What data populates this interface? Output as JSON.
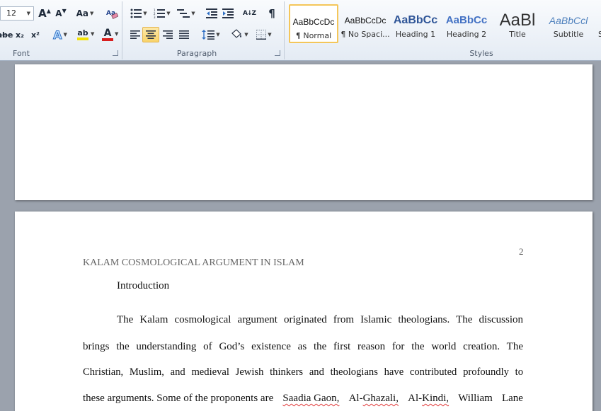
{
  "ribbon": {
    "font": {
      "label": "Font",
      "size": "12",
      "grow_glyph": "A",
      "shrink_glyph": "A",
      "change_case_glyph": "Aa",
      "strike_glyph": "abe",
      "sub_glyph": "x₂",
      "sup_glyph": "x²",
      "effects_glyph": "A",
      "highlight_glyph": "ab",
      "font_color_glyph": "A"
    },
    "paragraph": {
      "label": "Paragraph",
      "sort_glyph": "A↓Z",
      "pilcrow_glyph": "¶"
    },
    "styles": {
      "label": "Styles",
      "items": [
        {
          "preview": "AaBbCcDc",
          "name": "¶ Normal"
        },
        {
          "preview": "AaBbCcDc",
          "name": "¶ No Spaci..."
        },
        {
          "preview": "AaBbCc",
          "name": "Heading 1"
        },
        {
          "preview": "AaBbCc",
          "name": "Heading 2"
        },
        {
          "preview": "AaBl",
          "name": "Title"
        },
        {
          "preview": "AaBbCcl",
          "name": "Subtitle"
        },
        {
          "preview": "",
          "name": "S"
        }
      ]
    },
    "colors": {
      "highlight": "#f2e205",
      "font_color": "#d81e1e",
      "selected_border": "#f4c65a"
    }
  },
  "document": {
    "page_number": "2",
    "running_head": "KALAM COSMOLOGICAL ARGUMENT IN ISLAM",
    "intro": "Introduction",
    "lines": {
      "l1": "The Kalam cosmological argument originated from Islamic theologians. The discussion",
      "l2": "brings the understanding of God’s existence as the first reason for the world creation. The",
      "l3": "Christian, Muslim, and medieval Jewish thinkers and theologians have contributed profoundly to",
      "l4_a": "these arguments. Some of the proponents are",
      "l4_b": "Saadia Gaon,",
      "l4_c": "Al-",
      "l4_d": "Ghazali,",
      "l4_e": "Al-",
      "l4_f": "Kindi,",
      "l4_g": "William",
      "l4_h": "Lane"
    }
  }
}
